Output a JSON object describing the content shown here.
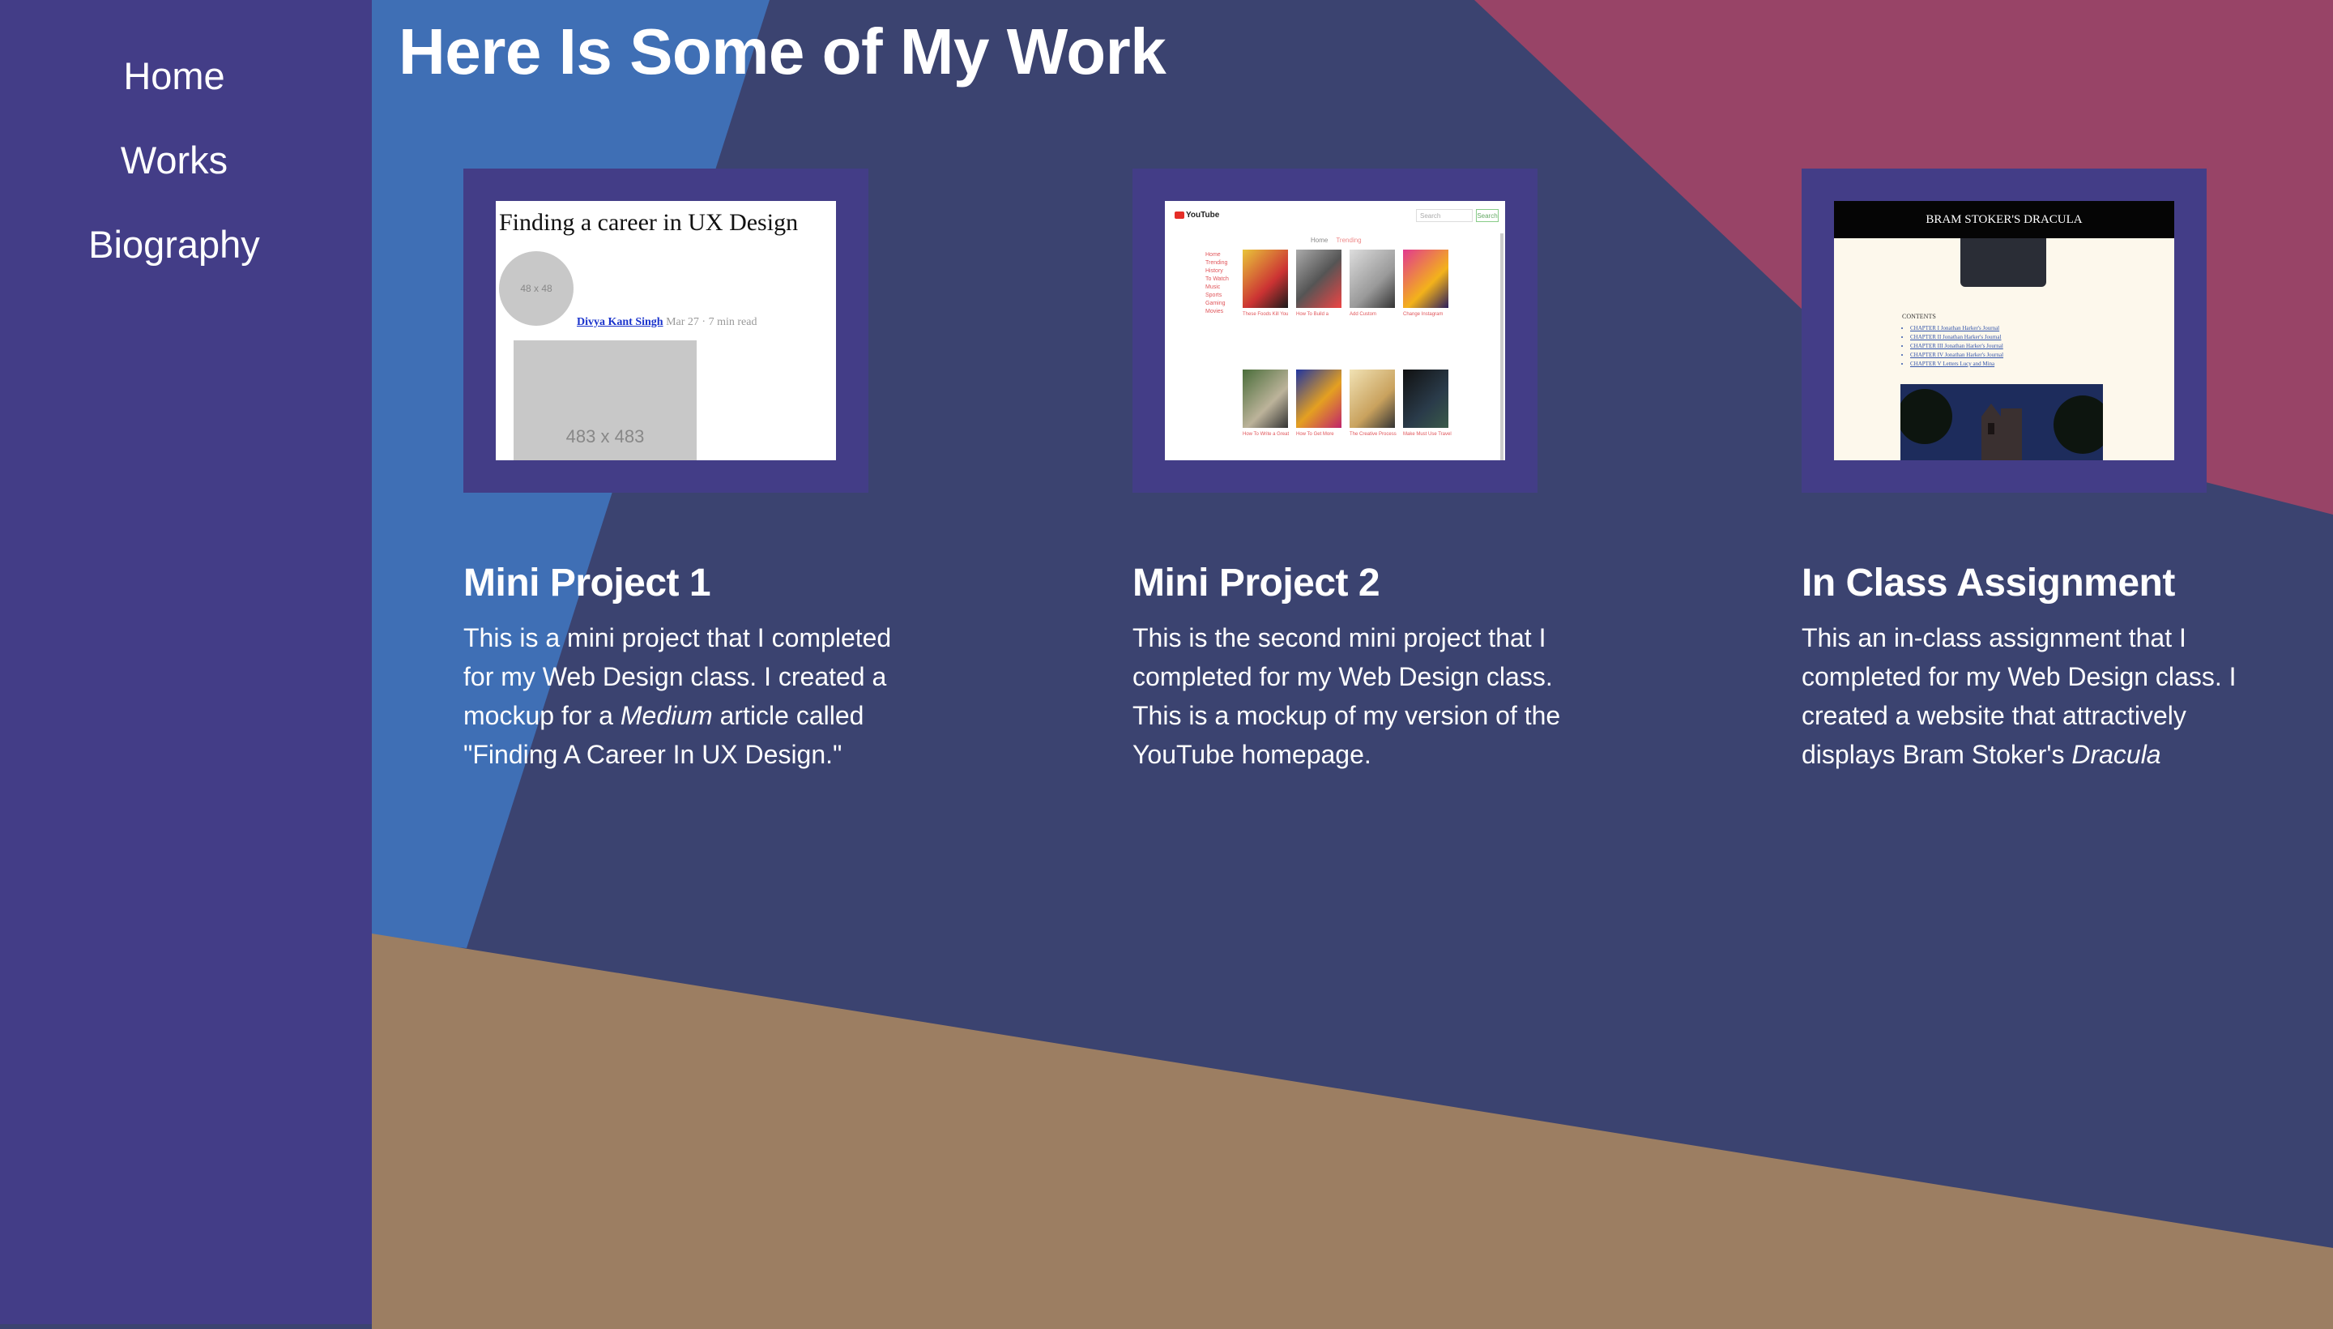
{
  "nav": {
    "items": [
      {
        "label": "Home"
      },
      {
        "label": "Works"
      },
      {
        "label": "Biography"
      }
    ]
  },
  "page": {
    "title": "Here Is Some of My Work"
  },
  "projects": [
    {
      "title": "Mini Project 1",
      "desc_before": "This is a mini project that I completed for my Web Design class. I created a mockup for a ",
      "desc_em": "Medium",
      "desc_after": " article called \"Finding A Career In UX Design.\"",
      "thumb": {
        "article_title": "Finding a career in UX Design",
        "avatar_placeholder": "48 x 48",
        "author": "Divya Kant Singh",
        "meta": "Mar 27 · 7 min read",
        "image_placeholder": "483 x 483"
      }
    },
    {
      "title": "Mini Project 2",
      "desc_before": "This is the second mini project that I completed for my Web Design class. This is a mockup of my version of the YouTube homepage.",
      "desc_em": "",
      "desc_after": "",
      "thumb": {
        "logo": "YouTube",
        "search_placeholder": "Search",
        "search_button": "Search",
        "tab_home": "Home",
        "tab_trending": "Trending",
        "sidebar": [
          "Home",
          "Trending",
          "History",
          "To Watch",
          "Music",
          "Sports",
          "Gaming",
          "Movies"
        ],
        "captions_row1": [
          "These Foods Kill You",
          "How To Build a",
          "Add Custom",
          "Change Instagram"
        ],
        "captions_row2": [
          "How To Write a Great",
          "How To Get More",
          "The Creative Process",
          "Make Must Use Travel"
        ]
      }
    },
    {
      "title": "In Class Assignment",
      "desc_before": "This an in-class assignment that I completed for my Web Design class. I created a website that attractively displays Bram Stoker's ",
      "desc_em": "Dracula",
      "desc_after": "",
      "thumb": {
        "header": "BRAM STOKER'S DRACULA",
        "contents_label": "CONTENTS",
        "chapters": [
          "CHAPTER I Jonathan Harker's Journal",
          "CHAPTER II Jonathan Harker's Journal",
          "CHAPTER III Jonathan Harker's Journal",
          "CHAPTER IV Jonathan Harker's Journal",
          "CHAPTER V Letters Lucy and Mina"
        ]
      }
    }
  ],
  "colors": {
    "sidebar": "#433d87",
    "background": "#3b4370",
    "accent_blue": "#3f6fb5",
    "accent_pink": "#984467",
    "accent_tan": "#9c7e62"
  }
}
